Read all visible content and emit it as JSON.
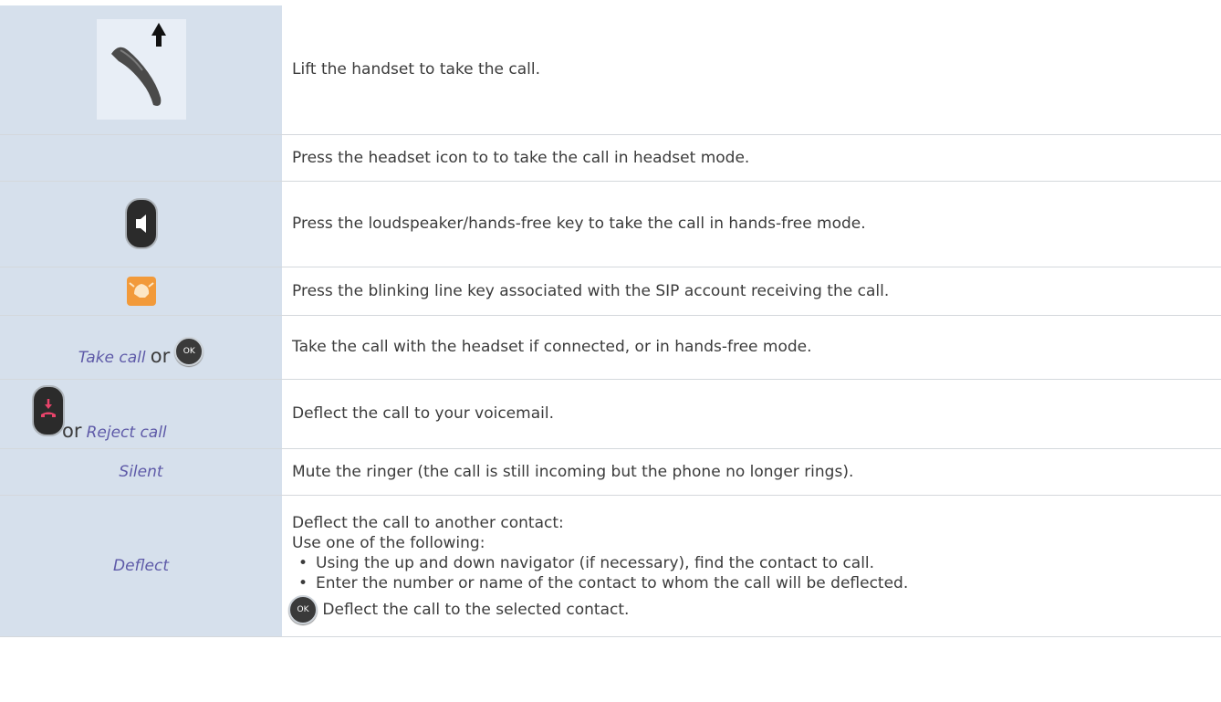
{
  "rows": [
    {
      "icon": "handset-lift-icon",
      "text": "Lift the handset to take the call."
    },
    {
      "icon": "",
      "text": "Press the headset icon to to take the call in headset mode."
    },
    {
      "icon": "loudspeaker-key-icon",
      "text": "Press the loudspeaker/hands-free key to take the call in hands-free mode."
    },
    {
      "icon": "line-key-icon",
      "text": "Press the blinking line key associated with the SIP account receiving the call."
    },
    {
      "left_label": "Take call",
      "or": "or",
      "ok_label": "OK",
      "text": "Take the call with the headset if connected, or in hands-free mode."
    },
    {
      "or": "or",
      "left_label": "Reject call",
      "icon": "reject-key-icon",
      "text": "Deflect the call to your voicemail."
    },
    {
      "left_label": "Silent",
      "text": "Mute the ringer (the call is still incoming but the phone no longer rings)."
    },
    {
      "left_label": "Deflect",
      "lines": [
        "Deflect the call to another contact:",
        "Use one of the following:"
      ],
      "bullets": [
        "Using the up and down navigator (if necessary), find the contact to call.",
        "Enter the number or name of the contact to whom the call will be deflected."
      ],
      "ok_label": "OK",
      "final": "Deflect the call to the selected contact."
    }
  ],
  "colors": {
    "icon_column_bg": "#d6e0ec",
    "italic_text": "#5e5aa8",
    "reject_accent": "#e8436a",
    "line_key_orange": "#f29a3a"
  }
}
